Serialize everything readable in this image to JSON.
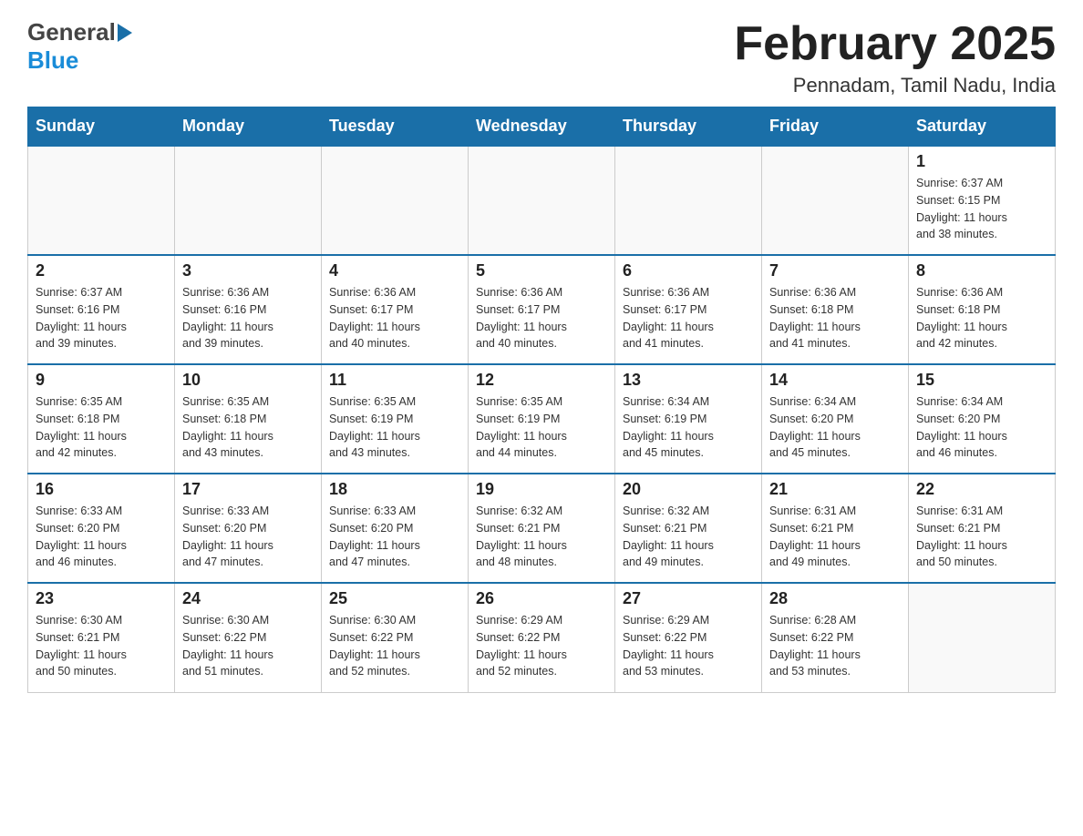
{
  "header": {
    "logo": {
      "general": "General",
      "blue": "Blue"
    },
    "title": "February 2025",
    "location": "Pennadam, Tamil Nadu, India"
  },
  "calendar": {
    "weekdays": [
      "Sunday",
      "Monday",
      "Tuesday",
      "Wednesday",
      "Thursday",
      "Friday",
      "Saturday"
    ],
    "weeks": [
      [
        {
          "day": "",
          "info": ""
        },
        {
          "day": "",
          "info": ""
        },
        {
          "day": "",
          "info": ""
        },
        {
          "day": "",
          "info": ""
        },
        {
          "day": "",
          "info": ""
        },
        {
          "day": "",
          "info": ""
        },
        {
          "day": "1",
          "info": "Sunrise: 6:37 AM\nSunset: 6:15 PM\nDaylight: 11 hours\nand 38 minutes."
        }
      ],
      [
        {
          "day": "2",
          "info": "Sunrise: 6:37 AM\nSunset: 6:16 PM\nDaylight: 11 hours\nand 39 minutes."
        },
        {
          "day": "3",
          "info": "Sunrise: 6:36 AM\nSunset: 6:16 PM\nDaylight: 11 hours\nand 39 minutes."
        },
        {
          "day": "4",
          "info": "Sunrise: 6:36 AM\nSunset: 6:17 PM\nDaylight: 11 hours\nand 40 minutes."
        },
        {
          "day": "5",
          "info": "Sunrise: 6:36 AM\nSunset: 6:17 PM\nDaylight: 11 hours\nand 40 minutes."
        },
        {
          "day": "6",
          "info": "Sunrise: 6:36 AM\nSunset: 6:17 PM\nDaylight: 11 hours\nand 41 minutes."
        },
        {
          "day": "7",
          "info": "Sunrise: 6:36 AM\nSunset: 6:18 PM\nDaylight: 11 hours\nand 41 minutes."
        },
        {
          "day": "8",
          "info": "Sunrise: 6:36 AM\nSunset: 6:18 PM\nDaylight: 11 hours\nand 42 minutes."
        }
      ],
      [
        {
          "day": "9",
          "info": "Sunrise: 6:35 AM\nSunset: 6:18 PM\nDaylight: 11 hours\nand 42 minutes."
        },
        {
          "day": "10",
          "info": "Sunrise: 6:35 AM\nSunset: 6:18 PM\nDaylight: 11 hours\nand 43 minutes."
        },
        {
          "day": "11",
          "info": "Sunrise: 6:35 AM\nSunset: 6:19 PM\nDaylight: 11 hours\nand 43 minutes."
        },
        {
          "day": "12",
          "info": "Sunrise: 6:35 AM\nSunset: 6:19 PM\nDaylight: 11 hours\nand 44 minutes."
        },
        {
          "day": "13",
          "info": "Sunrise: 6:34 AM\nSunset: 6:19 PM\nDaylight: 11 hours\nand 45 minutes."
        },
        {
          "day": "14",
          "info": "Sunrise: 6:34 AM\nSunset: 6:20 PM\nDaylight: 11 hours\nand 45 minutes."
        },
        {
          "day": "15",
          "info": "Sunrise: 6:34 AM\nSunset: 6:20 PM\nDaylight: 11 hours\nand 46 minutes."
        }
      ],
      [
        {
          "day": "16",
          "info": "Sunrise: 6:33 AM\nSunset: 6:20 PM\nDaylight: 11 hours\nand 46 minutes."
        },
        {
          "day": "17",
          "info": "Sunrise: 6:33 AM\nSunset: 6:20 PM\nDaylight: 11 hours\nand 47 minutes."
        },
        {
          "day": "18",
          "info": "Sunrise: 6:33 AM\nSunset: 6:20 PM\nDaylight: 11 hours\nand 47 minutes."
        },
        {
          "day": "19",
          "info": "Sunrise: 6:32 AM\nSunset: 6:21 PM\nDaylight: 11 hours\nand 48 minutes."
        },
        {
          "day": "20",
          "info": "Sunrise: 6:32 AM\nSunset: 6:21 PM\nDaylight: 11 hours\nand 49 minutes."
        },
        {
          "day": "21",
          "info": "Sunrise: 6:31 AM\nSunset: 6:21 PM\nDaylight: 11 hours\nand 49 minutes."
        },
        {
          "day": "22",
          "info": "Sunrise: 6:31 AM\nSunset: 6:21 PM\nDaylight: 11 hours\nand 50 minutes."
        }
      ],
      [
        {
          "day": "23",
          "info": "Sunrise: 6:30 AM\nSunset: 6:21 PM\nDaylight: 11 hours\nand 50 minutes."
        },
        {
          "day": "24",
          "info": "Sunrise: 6:30 AM\nSunset: 6:22 PM\nDaylight: 11 hours\nand 51 minutes."
        },
        {
          "day": "25",
          "info": "Sunrise: 6:30 AM\nSunset: 6:22 PM\nDaylight: 11 hours\nand 52 minutes."
        },
        {
          "day": "26",
          "info": "Sunrise: 6:29 AM\nSunset: 6:22 PM\nDaylight: 11 hours\nand 52 minutes."
        },
        {
          "day": "27",
          "info": "Sunrise: 6:29 AM\nSunset: 6:22 PM\nDaylight: 11 hours\nand 53 minutes."
        },
        {
          "day": "28",
          "info": "Sunrise: 6:28 AM\nSunset: 6:22 PM\nDaylight: 11 hours\nand 53 minutes."
        },
        {
          "day": "",
          "info": ""
        }
      ]
    ]
  }
}
